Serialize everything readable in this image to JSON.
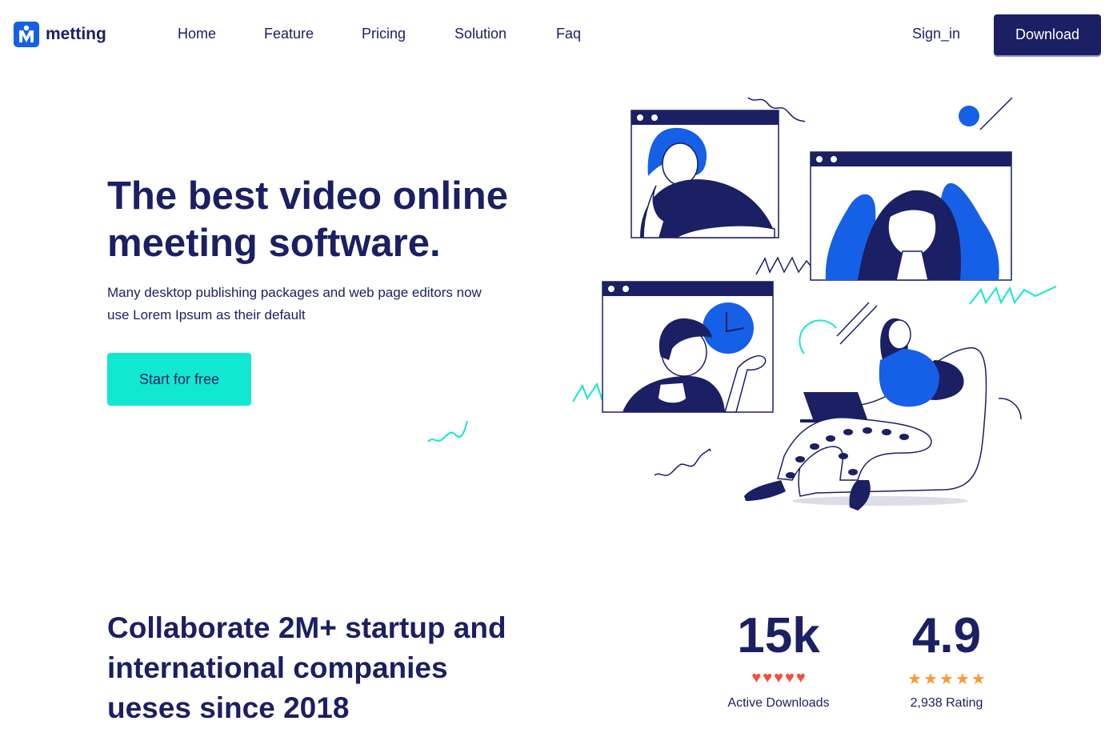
{
  "brand": {
    "name": "metting",
    "logo_letter": "M"
  },
  "nav": {
    "links": [
      "Home",
      "Feature",
      "Pricing",
      "Solution",
      "Faq"
    ],
    "sign_in": "Sign_in",
    "download": "Download"
  },
  "hero": {
    "title": "The best video online meeting software.",
    "subtitle": "Many desktop publishing packages and web page editors now use Lorem Ipsum as their default",
    "cta": "Start for free"
  },
  "stats_section": {
    "heading": "Collaborate 2M+ startup and international companies ueses since 2018",
    "stats": [
      {
        "value": "15k",
        "label": "Active Downloads",
        "icon": "heart-icon",
        "count": 5
      },
      {
        "value": "4.9",
        "label": "2,938 Rating",
        "icon": "star-icon",
        "count": 5
      }
    ]
  },
  "colors": {
    "primary": "#1b1f63",
    "accent_blue": "#1560e6",
    "accent_teal": "#12e8cf",
    "heart": "#f2503c",
    "star": "#f79a3a"
  }
}
